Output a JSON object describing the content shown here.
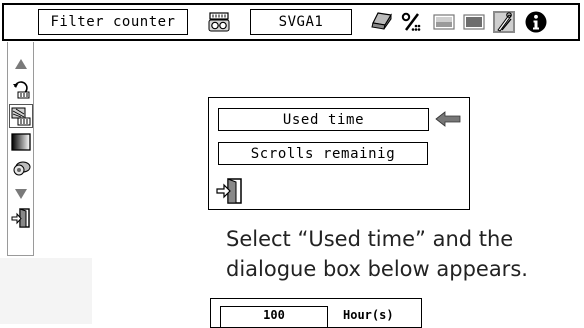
{
  "menu": {
    "title": "Filter counter",
    "mode": "SVGA1",
    "icons": [
      "projector-icon",
      "pc-adjust-icon",
      "image-adjust-icon",
      "image-icon",
      "screen-icon",
      "setting-icon",
      "info-icon"
    ]
  },
  "sidebar": {
    "icons": [
      "scroll-up-icon",
      "filter-reset-icon",
      "filter-counter-icon",
      "color-swatch-icon",
      "lamp-counter-icon",
      "scroll-down-icon",
      "exit-icon"
    ]
  },
  "panel": {
    "options": [
      "Used time",
      "Scrolls remainig"
    ],
    "selected_index": 0
  },
  "caption": {
    "line1": "Select “Used time” and the",
    "line2": "dialogue box below appears."
  },
  "preview": {
    "value": "100",
    "unit": "Hour(s)"
  }
}
